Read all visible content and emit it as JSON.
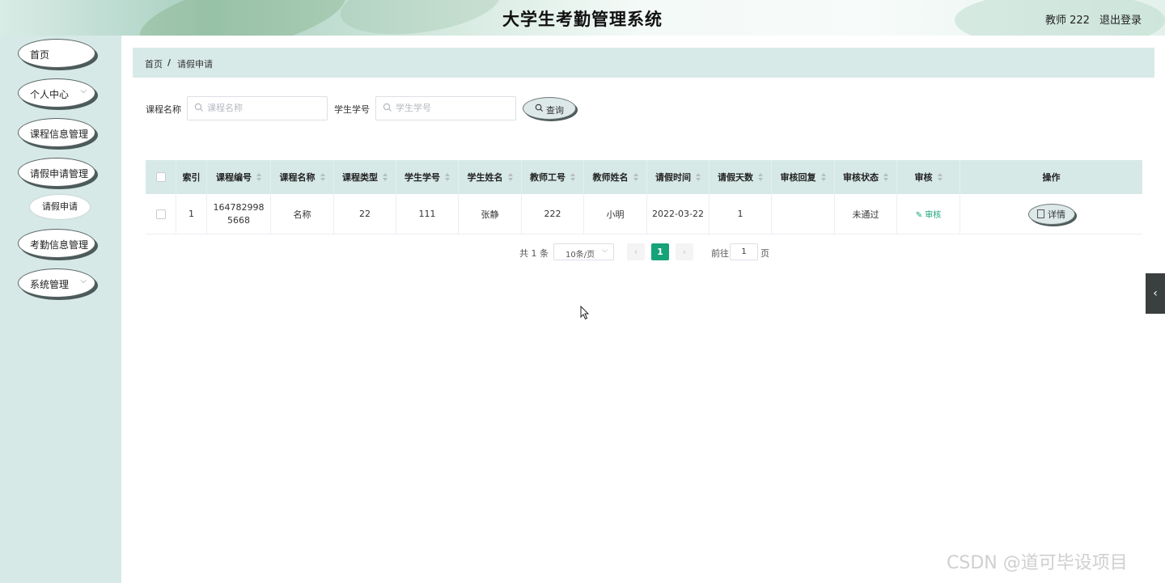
{
  "header": {
    "title": "大学生考勤管理系统",
    "user": "教师 222",
    "logout": "退出登录"
  },
  "sidebar": {
    "items": [
      {
        "label": "首页"
      },
      {
        "label": "个人中心"
      },
      {
        "label": "课程信息管理"
      },
      {
        "label": "请假申请管理"
      },
      {
        "label": "请假申请"
      },
      {
        "label": "考勤信息管理"
      },
      {
        "label": "系统管理"
      }
    ]
  },
  "breadcrumb": {
    "home": "首页",
    "separator": "/",
    "current": "请假申请"
  },
  "search": {
    "course_label": "课程名称",
    "course_placeholder": "课程名称",
    "student_label": "学生学号",
    "student_placeholder": "学生学号",
    "query_button": "查询"
  },
  "table": {
    "headers": [
      "索引",
      "课程编号",
      "课程名称",
      "课程类型",
      "学生学号",
      "学生姓名",
      "教师工号",
      "教师姓名",
      "请假时间",
      "请假天数",
      "审核回复",
      "审核状态",
      "审核",
      "操作"
    ],
    "rows": [
      {
        "index": "1",
        "course_no": "1647829985668",
        "course_name": "名称",
        "course_type": "22",
        "student_no": "111",
        "student_name": "张静",
        "teacher_no": "222",
        "teacher_name": "小明",
        "leave_time": "2022-03-22",
        "leave_days": "1",
        "reply": "",
        "status": "未通过",
        "audit_link": "审核",
        "detail_button": "详情"
      }
    ]
  },
  "pagination": {
    "total": "共 1 条",
    "page_size": "10条/页",
    "current_page": "1",
    "goto_label": "前往",
    "goto_value": "1",
    "page_suffix": "页"
  },
  "watermark": "CSDN @道可毕设项目",
  "colors": {
    "accent": "#16a37a",
    "sidebar_bg": "#d6e9e6",
    "header_row_bg": "#d6e9e6"
  }
}
